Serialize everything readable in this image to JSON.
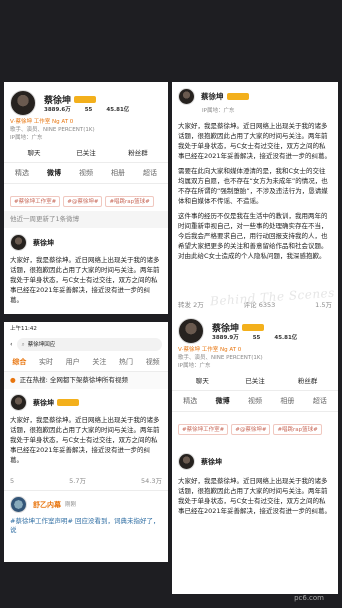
{
  "profile": {
    "name": "蔡徐坤",
    "followers_a": "3889.6万",
    "followers_b": "3889.9万",
    "likes": "45.81亿",
    "following": "55",
    "verified": "V·蔡徐坤 工作室 Ng AT 0",
    "bio": "歌手、演员、NINE PERCENT(1K)",
    "ip": "IP属地：广东"
  },
  "actions": {
    "chat": "聊天",
    "follow": "已关注",
    "mute": "粉丝群"
  },
  "tabs": [
    "精选",
    "微博",
    "视频",
    "相册",
    "超话"
  ],
  "tags": [
    "#蔡徐坤工作室#",
    "#@蔡徐坤#",
    "#唱跳rap篮球#"
  ],
  "refresh_note": "他近一周更新了1条微博",
  "post": {
    "text": "大家好，我是蔡徐坤。近日网络上出现关于我的诸多话题，很抱歉因此占用了大家的时间与关注。两年前我处于单身状态，与C女士有过交往，双方之间的私事已经在2021年妥善解决，接近没有进一步的纠葛。",
    "text_mid": "需要在此向大家和媒体澄清的是，我和C女士的交往均属双方自愿，也不存在“女方为未成年”的情况，也不存在所谓的“强制堕胎”，不涉及违法行为，恳请媒体和自媒体不传谣、不造谣。",
    "text_end": "这件事的经历不仅是我在生活中的教训，我用两年的时间重新审视自己，对一些事的处理确实存在不当，今后我会严格要求自己，用行动回报支持我的人，也希望大家把更多的关注和善意留给作品和社会议题。对由此给C女士造成的个人隐私问题，我深感抱歉。",
    "stats": {
      "repost": "转发 2万",
      "comment": "评论 6353",
      "like": "1.5万"
    },
    "stats_b": {
      "repost": "5",
      "comment": "5.7万",
      "like": "54.3万"
    }
  },
  "search": {
    "time": "上午11:42",
    "query": "蔡徐坤回应",
    "tabs": [
      "综合",
      "实时",
      "用户",
      "关注",
      "热门",
      "视频"
    ],
    "hot": "正在热搜: 全网都下架蔡徐坤所有视频"
  },
  "post2": {
    "author": "舒乙内幕",
    "date": "刚刚",
    "text": "#蔡徐坤工作室声明# 回应没看到，词典未指好了，说"
  },
  "caption": "Behind The Scenes",
  "watermark": "pc6.com"
}
